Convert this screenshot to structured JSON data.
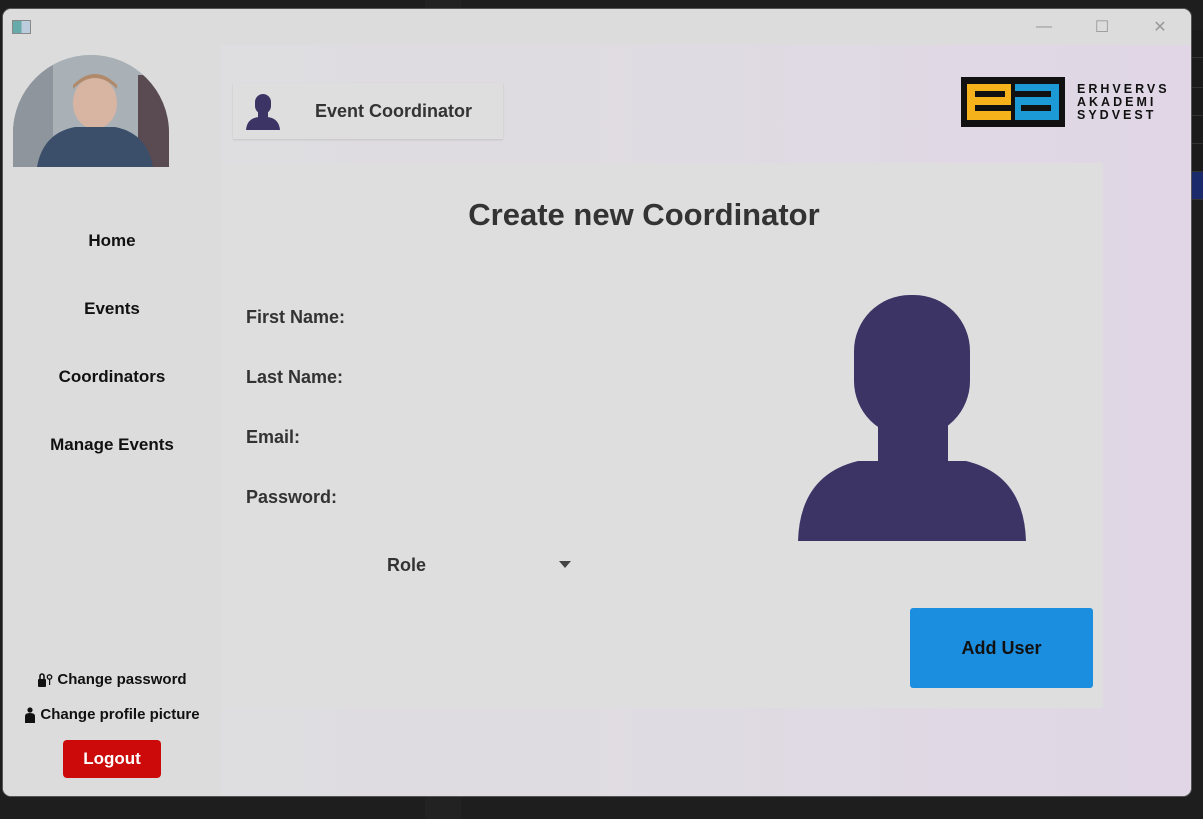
{
  "window": {
    "minimize": "—",
    "maximize": "☐",
    "close": "✕"
  },
  "sidebar": {
    "nav": [
      {
        "label": "Home"
      },
      {
        "label": "Events"
      },
      {
        "label": "Coordinators"
      },
      {
        "label": "Manage Events"
      }
    ],
    "change_password": "Change password",
    "change_profile_picture": "Change profile picture",
    "logout": "Logout"
  },
  "header": {
    "role_label": "Event Coordinator",
    "logo_lines": [
      "ERHVERVS",
      "AKADEMI",
      "SYDVEST"
    ],
    "logo_mark": "ea"
  },
  "form": {
    "title": "Create new Coordinator",
    "first_name_label": "First Name:",
    "last_name_label": "Last Name:",
    "email_label": "Email:",
    "password_label": "Password:",
    "role_label": "Role",
    "submit_label": "Add User",
    "first_name_value": "",
    "last_name_value": "",
    "email_value": "",
    "password_value": ""
  },
  "colors": {
    "accent_button": "#1c8ee0",
    "logout_button": "#cc0a0a",
    "silhouette": "#3d3466",
    "logo_yellow": "#f6b21b",
    "logo_blue": "#1c9ad6"
  },
  "icons": {
    "change_password": "lock-key-icon",
    "change_profile_picture": "person-icon",
    "role_chip": "user-silhouette-icon",
    "role_dropdown": "chevron-down-icon"
  }
}
